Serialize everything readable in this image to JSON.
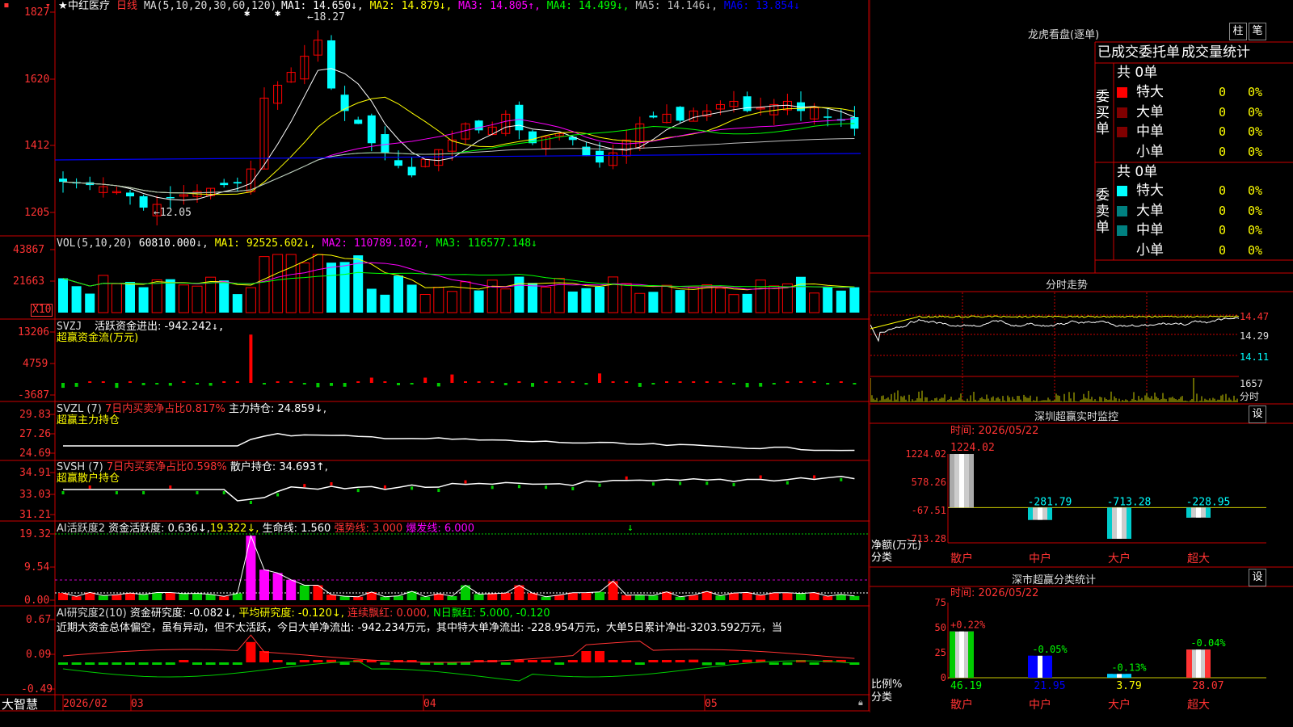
{
  "stock": {
    "name": "中红医疗",
    "period": "日线"
  },
  "main_panel": {
    "ma_label": "MA(5,10,20,30,60,120)",
    "ma": [
      {
        "label": "MA1: 14.650",
        "arrow": "↓",
        "color": "#ffffff"
      },
      {
        "label": "MA2: 14.879",
        "arrow": "↓",
        "color": "#ffff00"
      },
      {
        "label": "MA3: 14.805",
        "arrow": "↑",
        "color": "#ff00ff"
      },
      {
        "label": "MA4: 14.499",
        "arrow": "↓",
        "color": "#00ff00"
      },
      {
        "label": "MA5: 14.146",
        "arrow": "↓",
        "color": "#c0c0c0"
      },
      {
        "label": "MA6: 13.854",
        "arrow": "↓",
        "color": "#0000ff"
      }
    ],
    "y_ticks": [
      "1827",
      "1620",
      "1412",
      "1205"
    ],
    "high_label": "18.27",
    "low_label": "12.05"
  },
  "vol_panel": {
    "title": "VOL(5,10,20)",
    "value": "60810.000",
    "ma1": "MA1: 92525.602",
    "ma2": "MA2: 110789.102",
    "ma3": "MA3: 116577.148",
    "y_ticks": [
      "43867",
      "21663"
    ],
    "unit": "X10"
  },
  "svzj_panel": {
    "title": "SVZJ",
    "line1": "活跃资金进出: -942.242",
    "sub": "超赢资金流(万元)",
    "y_ticks": [
      "13206",
      "4759",
      "-3687"
    ]
  },
  "svzl_panel": {
    "title": "SVZL (7)",
    "pct": "7日内买卖净占比0.817%",
    "hold": "主力持仓: 24.859",
    "sub": "超赢主力持仓",
    "y_ticks": [
      "29.83",
      "27.26",
      "24.69"
    ]
  },
  "svsh_panel": {
    "title": "SVSH (7)",
    "pct": "7日内买卖净占比0.598%",
    "hold": "散户持仓: 34.693",
    "sub": "超赢散户持仓",
    "y_ticks": [
      "34.91",
      "33.03",
      "31.21"
    ]
  },
  "ai_panel": {
    "title": "AI活跃度2",
    "active": "资金活跃度: 0.636",
    "v2": "19.322",
    "life": "生命线: 1.560",
    "strong": "强势线: 3.000",
    "burst": "爆发线: 6.000",
    "y_ticks": [
      "19.32",
      "9.54",
      "0.00"
    ]
  },
  "ai2_panel": {
    "title": "AI研究度2(10)",
    "study": "资金研究度: -0.082",
    "avg": "平均研究度: -0.120",
    "red": "连续飘红: 0.000",
    "nred": "N日飘红: 5.000, -0.120",
    "desc": "近期大资金总体偏空，虽有异动，但不太活跃，今日大单净流出: -942.234万元，其中特大单净流出: -228.954万元，大单5日累计净出-3203.592万元，当",
    "y_ticks": [
      "0.67",
      "0.09",
      "-0.49"
    ]
  },
  "bottom_axis": {
    "logo": "大智慧",
    "labels": [
      "2026/02",
      "03",
      "04",
      "05"
    ]
  },
  "dragon": {
    "title": "龙虎看盘(逐单)",
    "btn_bar": "柱",
    "btn_order": "笔",
    "tabs": [
      "已成交委托单",
      "成交量统计"
    ],
    "buy_label": "委买单",
    "sell_label": "委卖单",
    "buy_total": "共 0单",
    "sell_total": "共 0单",
    "buy_rows": [
      {
        "name": "特大",
        "count": "0",
        "pct": "0%",
        "color": "#ff0000"
      },
      {
        "name": "大单",
        "count": "0",
        "pct": "0%",
        "color": "#800000"
      },
      {
        "name": "中单",
        "count": "0",
        "pct": "0%",
        "color": "#800000"
      },
      {
        "name": "小单",
        "count": "0",
        "pct": "0%",
        "color": "#000000"
      }
    ],
    "sell_rows": [
      {
        "name": "特大",
        "count": "0",
        "pct": "0%",
        "color": "#00ffff"
      },
      {
        "name": "大单",
        "count": "0",
        "pct": "0%",
        "color": "#008080"
      },
      {
        "name": "中单",
        "count": "0",
        "pct": "0%",
        "color": "#008080"
      },
      {
        "name": "小单",
        "count": "0",
        "pct": "0%",
        "color": "#000000"
      }
    ]
  },
  "intraday": {
    "title": "分时走势",
    "y_ticks": [
      "14.47",
      "14.29",
      "14.11"
    ],
    "vol_tick": "1657",
    "vol_unit": "分时"
  },
  "sz_monitor": {
    "title": "深圳超赢实时监控",
    "btn": "设",
    "time": "时间: 2026/05/22",
    "y_ticks": [
      "1224.02",
      "578.26",
      "-67.51",
      "-713.28"
    ],
    "ylabel": "净额(万元)",
    "xlabel": "分类",
    "categories": [
      "散户",
      "中户",
      "大户",
      "超大"
    ],
    "values": [
      1224.02,
      -281.79,
      -713.28,
      -228.95
    ],
    "value_labels": [
      "1224.02",
      "-281.79",
      "-713.28",
      "-228.95"
    ]
  },
  "sz_class": {
    "title": "深市超赢分类统计",
    "btn": "设",
    "time": "时间: 2026/05/22",
    "y_ticks": [
      "75",
      "50",
      "25",
      "0"
    ],
    "ylabel": "比例%",
    "xlabel": "分类",
    "categories": [
      "散户",
      "中户",
      "大户",
      "超大"
    ],
    "values": [
      46.19,
      21.95,
      3.79,
      28.07
    ],
    "value_labels": [
      "46.19",
      "21.95",
      "3.79",
      "28.07"
    ],
    "changes": [
      "+0.22%",
      "-0.05%",
      "-0.13%",
      "-0.04%"
    ]
  },
  "chart_data": [
    {
      "type": "bar",
      "title": "深圳超赢实时监控",
      "xlabel": "分类",
      "ylabel": "净额(万元)",
      "categories": [
        "散户",
        "中户",
        "大户",
        "超大"
      ],
      "values": [
        1224.02,
        -281.79,
        -713.28,
        -228.95
      ],
      "ylim": [
        -713.28,
        1224.02
      ]
    },
    {
      "type": "bar",
      "title": "深市超赢分类统计",
      "xlabel": "分类",
      "ylabel": "比例%",
      "categories": [
        "散户",
        "中户",
        "大户",
        "超大"
      ],
      "values": [
        46.19,
        21.95,
        3.79,
        28.07
      ],
      "ylim": [
        0,
        75
      ]
    }
  ],
  "colors": {
    "up": "#ff0000",
    "down": "#00ffff",
    "grid": "#cc0000",
    "label_red": "#ff3333",
    "yellow": "#ffff00"
  }
}
